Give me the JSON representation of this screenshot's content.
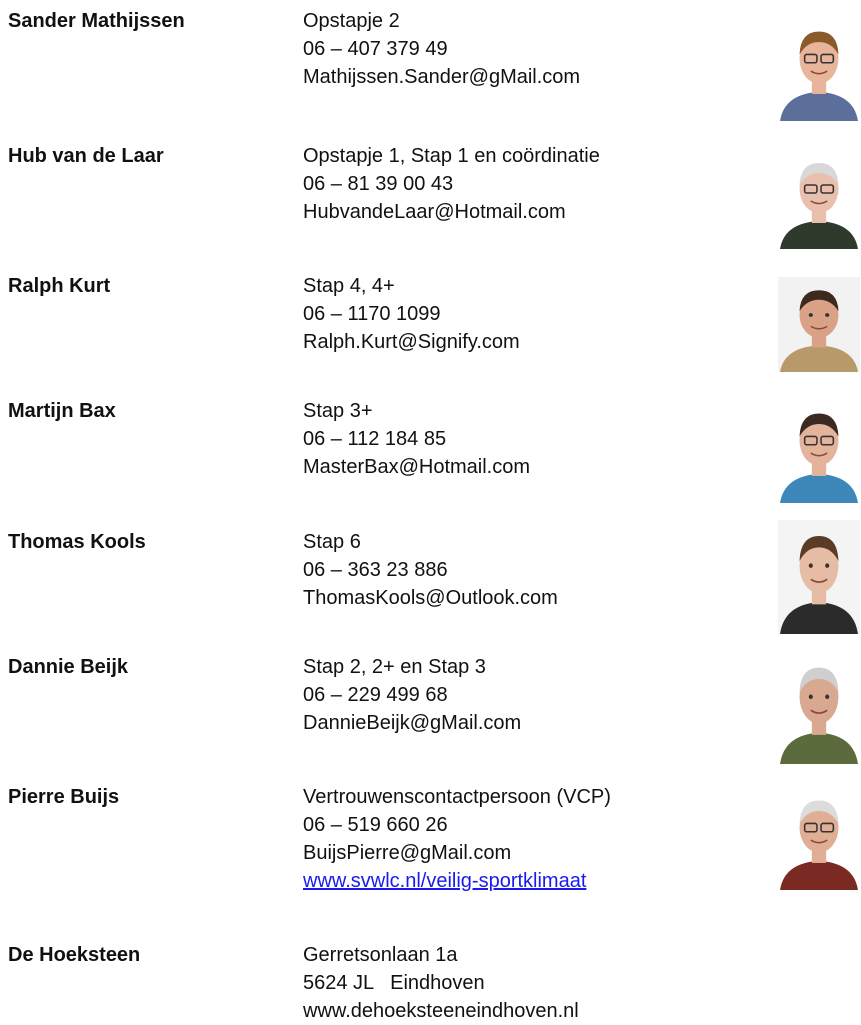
{
  "contacts": [
    {
      "name": "Sander Mathijssen",
      "role": "Opstapje 2",
      "phone": "06 – 407 379 49",
      "email": "Mathijssen.Sander@gMail.com",
      "photo": {
        "bg": "#ffffff",
        "skin": "#e8b49a",
        "hair": "#8a5a2b",
        "shirt": "#5c6f9a",
        "glasses": true
      }
    },
    {
      "name": "Hub van de Laar",
      "role": "Opstapje 1, Stap 1 en coördinatie",
      "phone": "06 – 81 39 00 43",
      "email": "HubvandeLaar@Hotmail.com",
      "photo": {
        "bg": "#ffffff",
        "skin": "#e9bfae",
        "hair": "#d8d8d8",
        "shirt": "#2f3a2c",
        "glasses": true
      }
    },
    {
      "name": "Ralph Kurt",
      "role": "Stap 4, 4+",
      "phone": "06 – 1170 1099",
      "email": "Ralph.Kurt@Signify.com",
      "photo": {
        "bg": "#f2f2f2",
        "skin": "#d9a286",
        "hair": "#3b2a1d",
        "shirt": "#b89a6a",
        "glasses": false
      }
    },
    {
      "name": "Martijn Bax",
      "role": "Stap 3+",
      "phone": "06 – 112 184 85",
      "email": "MasterBax@Hotmail.com",
      "photo": {
        "bg": "#ffffff",
        "skin": "#e3b39c",
        "hair": "#3a2a22",
        "shirt": "#3d88b8",
        "glasses": true
      }
    },
    {
      "name": "Thomas Kools",
      "role": "Stap 6",
      "phone": "06 – 363 23 886",
      "email": "ThomasKools@Outlook.com",
      "photo": {
        "bg": "#f4f4f4",
        "skin": "#e6bca4",
        "hair": "#5a3b25",
        "shirt": "#2b2b2b",
        "glasses": false
      }
    },
    {
      "name": "Dannie Beijk",
      "role": "Stap 2, 2+ en Stap 3",
      "phone": "06 – 229 499 68",
      "email": "DannieBeijk@gMail.com",
      "photo": {
        "bg": "#ffffff",
        "skin": "#d8a891",
        "hair": "#cfcfcf",
        "shirt": "#5b6b3d",
        "glasses": false
      }
    },
    {
      "name": "Pierre Buijs",
      "role": "Vertrouwenscontactpersoon (VCP)",
      "phone": "06 – 519 660 26",
      "email": "BuijsPierre@gMail.com",
      "link": "www.svwlc.nl/veilig-sportklimaat",
      "photo": {
        "bg": "#ffffff",
        "skin": "#e0ad95",
        "hair": "#dcdcdc",
        "shirt": "#7a2a22",
        "glasses": true
      }
    },
    {
      "name": "De Hoeksteen",
      "role": "Gerretsonlaan 1a",
      "phone": "5624 JL   Eindhoven",
      "email": "www.dehoeksteeneindhoven.nl"
    }
  ]
}
